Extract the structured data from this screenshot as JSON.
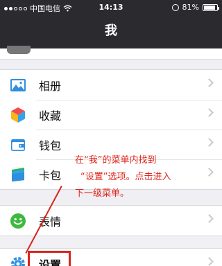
{
  "status": {
    "carrier": "中国电信",
    "time": "14:13",
    "battery": "81%",
    "battery_level": 0.81
  },
  "header": {
    "title": "我"
  },
  "menu": {
    "items": [
      {
        "label": "相册",
        "icon": "photo-album-icon"
      },
      {
        "label": "收藏",
        "icon": "favorites-cube-icon"
      },
      {
        "label": "钱包",
        "icon": "wallet-icon"
      },
      {
        "label": "卡包",
        "icon": "card-pack-icon"
      },
      {
        "label": "表情",
        "icon": "smiley-icon"
      },
      {
        "label": "设置",
        "icon": "gear-icon"
      }
    ]
  },
  "annotation": {
    "line1": "在“我”的菜单内找到",
    "line2": "“设置”选项。点击进入",
    "line3": "下一级菜单。",
    "color": "#e0251b"
  },
  "colors": {
    "header_bg": "#2a2a2f",
    "page_bg": "#efeff4"
  }
}
